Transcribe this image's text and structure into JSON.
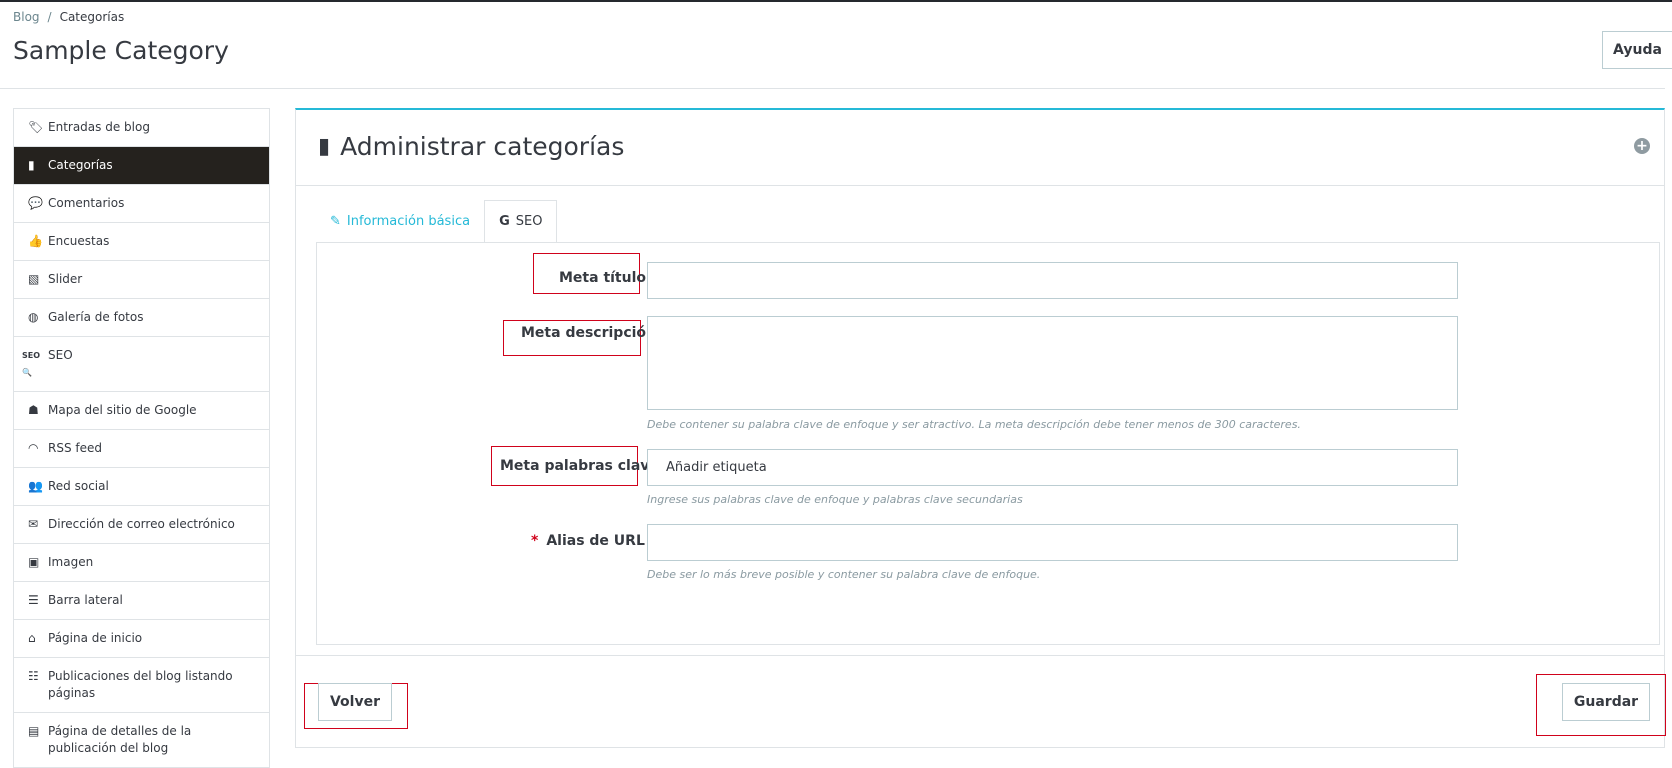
{
  "breadcrumb": {
    "parent": "Blog",
    "separator": "/",
    "current": "Categorías"
  },
  "page_title": "Sample Category",
  "help_label": "Ayuda",
  "sidebar": {
    "items": [
      {
        "label": "Entradas de blog",
        "icon": "tags-icon",
        "glyph": "🏷",
        "active": false
      },
      {
        "label": "Categorías",
        "icon": "book-icon",
        "glyph": "📕",
        "active": true
      },
      {
        "label": "Comentarios",
        "icon": "comments-icon",
        "glyph": "💬",
        "active": false
      },
      {
        "label": "Encuestas",
        "icon": "thumbs-up-icon",
        "glyph": "👍",
        "active": false
      },
      {
        "label": "Slider",
        "icon": "file-image-icon",
        "glyph": "🖻",
        "active": false
      },
      {
        "label": "Galería de fotos",
        "icon": "dashboard-icon",
        "glyph": "◍",
        "active": false
      },
      {
        "label": "SEO",
        "icon": "seo-icon",
        "glyph": "SEO",
        "active": false
      },
      {
        "label": "Mapa del sitio de Google",
        "icon": "sitemap-icon",
        "glyph": "☗",
        "active": false
      },
      {
        "label": "RSS feed",
        "icon": "rss-icon",
        "glyph": "◠",
        "active": false
      },
      {
        "label": "Red social",
        "icon": "users-icon",
        "glyph": "👥",
        "active": false
      },
      {
        "label": "Dirección de correo electrónico",
        "icon": "envelope-icon",
        "glyph": "✉",
        "active": false
      },
      {
        "label": "Imagen",
        "icon": "image-icon",
        "glyph": "🖼",
        "active": false
      },
      {
        "label": "Barra lateral",
        "icon": "server-icon",
        "glyph": "☰",
        "active": false
      },
      {
        "label": "Página de inicio",
        "icon": "home-icon",
        "glyph": "⌂",
        "active": false
      },
      {
        "label": "Publicaciones del blog listando páginas",
        "icon": "list-icon",
        "glyph": "☷",
        "active": false
      },
      {
        "label": "Página de detalles de la publicación del blog",
        "icon": "list-alt-icon",
        "glyph": "▤",
        "active": false
      }
    ]
  },
  "panel": {
    "title": "Administrar categorías",
    "tabs": [
      {
        "label": "Información básica",
        "icon": "edit-icon"
      },
      {
        "label": "SEO",
        "icon": "google-icon"
      }
    ],
    "fields": {
      "meta_title": {
        "label": "Meta título",
        "value": ""
      },
      "meta_description": {
        "label": "Meta descripción",
        "value": "",
        "help": "Debe contener su palabra clave de enfoque y ser atractivo. La meta descripción debe tener menos de 300 caracteres."
      },
      "meta_keywords": {
        "label": "Meta palabras clave",
        "placeholder": "Añadir etiqueta",
        "help": "Ingrese sus palabras clave de enfoque y palabras clave secundarias"
      },
      "url_alias": {
        "label": "Alias de URL",
        "required_mark": "*",
        "value": "",
        "help": "Debe ser lo más breve posible y contener su palabra clave de enfoque."
      }
    },
    "back_label": "Volver",
    "save_label": "Guardar"
  },
  "colors": {
    "accent": "#25b9d7",
    "active_bg": "#25221e",
    "highlight_box": "#d0021b"
  }
}
